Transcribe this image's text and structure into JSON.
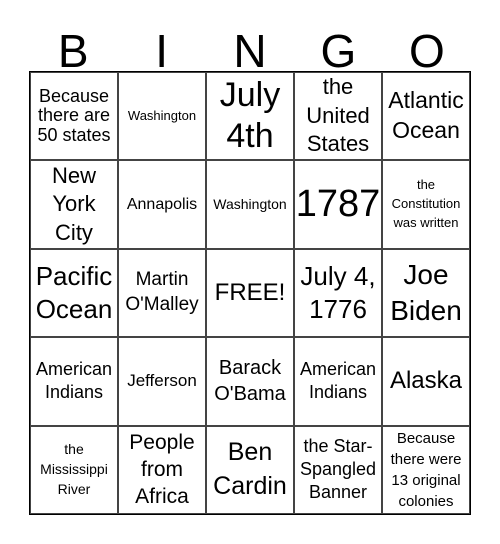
{
  "header": [
    "B",
    "I",
    "N",
    "G",
    "O"
  ],
  "cells": [
    "Because there are 50 states",
    "Washington",
    "July 4th",
    "the United States",
    "Atlantic Ocean",
    "New York City",
    "Annapolis",
    "Washington",
    "1787",
    "the Constitution was written",
    "Pacific Ocean",
    "Martin O'Malley",
    "FREE!",
    "July 4, 1776",
    "Joe Biden",
    "American Indians",
    "Jefferson",
    "Barack O'Bama",
    "American Indians",
    "Alaska",
    "the Mississippi River",
    "People from Africa",
    "Ben Cardin",
    "the Star-Spangled Banner",
    "Because there were 13 original colonies"
  ]
}
